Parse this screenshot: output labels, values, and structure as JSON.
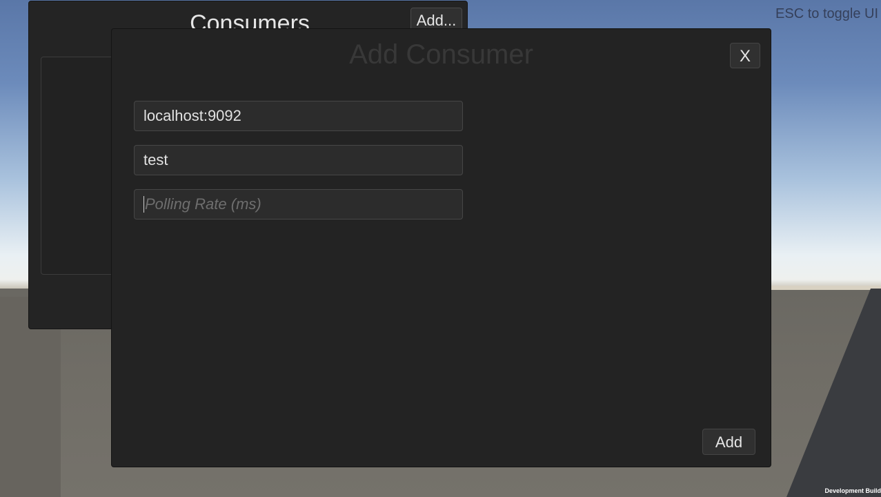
{
  "hud": {
    "esc_hint": "ESC to toggle UI",
    "dev_build": "Development Build"
  },
  "consumers_panel": {
    "title": "Consumers",
    "add_label": "Add..."
  },
  "add_consumer_dialog": {
    "title": "Add Consumer",
    "close_label": "X",
    "fields": {
      "server": {
        "value": "localhost:9092"
      },
      "topic": {
        "value": "test"
      },
      "polling_rate": {
        "value": "",
        "placeholder": "Polling Rate (ms)"
      }
    },
    "submit_label": "Add"
  }
}
